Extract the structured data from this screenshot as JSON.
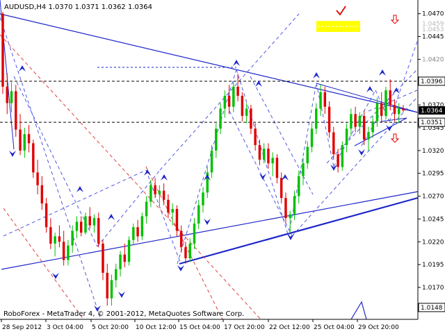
{
  "header": {
    "symbol_line": "AUDUSD,H4  1.0370 1.0371 1.0362 1.0364"
  },
  "footer": {
    "copyright": "RoboForex - MetaTrader 4, © 2001-2012, MetaQuotes Software Corp."
  },
  "chart_data": {
    "type": "candlestick",
    "symbol": "AUDUSD",
    "timeframe": "H4",
    "ohlc_current": {
      "open": 1.037,
      "high": 1.0371,
      "low": 1.0362,
      "close": 1.0364
    },
    "ylim": [
      1.0135,
      1.0485
    ],
    "x_tick_labels": [
      "28 Sep 2012",
      "3 Oct 04:00",
      "5 Oct 20:00",
      "10 Oct 12:00",
      "15 Oct 04:00",
      "17 Oct 20:00",
      "22 Oct 12:00",
      "25 Oct 04:00",
      "29 Oct 20:00"
    ],
    "y_tick_labels": [
      "1.0470",
      "1.0445",
      "1.0420",
      "1.0370",
      "1.0345",
      "1.0320",
      "1.0295",
      "1.0270",
      "1.0245",
      "1.0220",
      "1.0195",
      "1.0170"
    ],
    "y_tick_values": [
      1.047,
      1.0445,
      1.042,
      1.037,
      1.0345,
      1.032,
      1.0295,
      1.027,
      1.0245,
      1.022,
      1.0195,
      1.017
    ],
    "price_labels": [
      {
        "text": "1.0459",
        "value": 1.0459,
        "style": "muted"
      },
      {
        "text": "1.0453",
        "value": 1.0453,
        "style": "muted"
      },
      {
        "text": "1.0420",
        "value": 1.042,
        "style": "muted"
      },
      {
        "text": "1.0396",
        "value": 1.0396,
        "style": "boxed"
      },
      {
        "text": "1.0364",
        "value": 1.0364,
        "style": "current"
      },
      {
        "text": "1.0351",
        "value": 1.0351,
        "style": "boxed"
      },
      {
        "text": "1.0148",
        "value": 1.0148,
        "style": "boxed"
      }
    ],
    "horizontal_levels": [
      1.0396,
      1.0351
    ],
    "highlight_zone": {
      "y_top": 1.0462,
      "y_bottom": 1.045
    },
    "colors": {
      "bull": "#00c000",
      "bear": "#e00000",
      "trend": "#1c25c8",
      "dashed": "#5057e0",
      "diag_red": "#e04040",
      "zone": "#ffff00",
      "marker": "#e00000"
    },
    "candles": [
      [
        1.047,
        1.0472,
        1.0382,
        1.039
      ],
      [
        1.039,
        1.0405,
        1.036,
        1.0372
      ],
      [
        1.0372,
        1.0395,
        1.0362,
        1.0385
      ],
      [
        1.0385,
        1.0392,
        1.0335,
        1.0343
      ],
      [
        1.0343,
        1.036,
        1.0315,
        1.032
      ],
      [
        1.032,
        1.0345,
        1.0312,
        1.0338
      ],
      [
        1.0338,
        1.0348,
        1.0318,
        1.0328
      ],
      [
        1.0328,
        1.0332,
        1.029,
        1.0296
      ],
      [
        1.0296,
        1.031,
        1.0272,
        1.0282
      ],
      [
        1.0282,
        1.0292,
        1.0255,
        1.0262
      ],
      [
        1.0262,
        1.0268,
        1.023,
        1.0236
      ],
      [
        1.0236,
        1.0246,
        1.0212,
        1.0218
      ],
      [
        1.0218,
        1.023,
        1.0204,
        1.0226
      ],
      [
        1.0226,
        1.0238,
        1.0214,
        1.022
      ],
      [
        1.022,
        1.0232,
        1.0194,
        1.02
      ],
      [
        1.02,
        1.0222,
        1.0194,
        1.0216
      ],
      [
        1.0216,
        1.0238,
        1.0208,
        1.0232
      ],
      [
        1.0232,
        1.0248,
        1.0224,
        1.0242
      ],
      [
        1.0242,
        1.0248,
        1.0226,
        1.023
      ],
      [
        1.023,
        1.0252,
        1.0228,
        1.0248
      ],
      [
        1.0248,
        1.0258,
        1.0234,
        1.0238
      ],
      [
        1.0238,
        1.025,
        1.023,
        1.0246
      ],
      [
        1.0246,
        1.0252,
        1.0214,
        1.0218
      ],
      [
        1.0218,
        1.0222,
        1.0178,
        1.0186
      ],
      [
        1.0186,
        1.0196,
        1.015,
        1.0158
      ],
      [
        1.0158,
        1.0184,
        1.015,
        1.0178
      ],
      [
        1.0178,
        1.0196,
        1.017,
        1.019
      ],
      [
        1.019,
        1.021,
        1.0182,
        1.0206
      ],
      [
        1.0206,
        1.0218,
        1.0192,
        1.0198
      ],
      [
        1.0198,
        1.0226,
        1.0194,
        1.0222
      ],
      [
        1.0222,
        1.024,
        1.0216,
        1.0236
      ],
      [
        1.0236,
        1.0244,
        1.022,
        1.0226
      ],
      [
        1.0226,
        1.0252,
        1.0222,
        1.0248
      ],
      [
        1.0248,
        1.027,
        1.024,
        1.0264
      ],
      [
        1.0264,
        1.0288,
        1.0258,
        1.0282
      ],
      [
        1.0282,
        1.029,
        1.0268,
        1.0272
      ],
      [
        1.0272,
        1.0282,
        1.0258,
        1.0276
      ],
      [
        1.0276,
        1.0284,
        1.026,
        1.0266
      ],
      [
        1.0266,
        1.0272,
        1.0246,
        1.0252
      ],
      [
        1.0252,
        1.0262,
        1.0238,
        1.0256
      ],
      [
        1.0256,
        1.026,
        1.0226,
        1.0232
      ],
      [
        1.0232,
        1.0238,
        1.0208,
        1.0214
      ],
      [
        1.0214,
        1.022,
        1.0196,
        1.0202
      ],
      [
        1.0202,
        1.0224,
        1.0198,
        1.0218
      ],
      [
        1.0218,
        1.0246,
        1.0212,
        1.024
      ],
      [
        1.024,
        1.0266,
        1.0234,
        1.026
      ],
      [
        1.026,
        1.028,
        1.0252,
        1.0274
      ],
      [
        1.0274,
        1.0302,
        1.0268,
        1.0296
      ],
      [
        1.0296,
        1.0326,
        1.029,
        1.032
      ],
      [
        1.032,
        1.035,
        1.0312,
        1.0344
      ],
      [
        1.0344,
        1.0372,
        1.0338,
        1.0366
      ],
      [
        1.0366,
        1.0386,
        1.0356,
        1.038
      ],
      [
        1.038,
        1.0392,
        1.036,
        1.0368
      ],
      [
        1.0368,
        1.0396,
        1.0362,
        1.039
      ],
      [
        1.039,
        1.0404,
        1.0374,
        1.038
      ],
      [
        1.038,
        1.0384,
        1.0352,
        1.0358
      ],
      [
        1.0358,
        1.0372,
        1.035,
        1.0366
      ],
      [
        1.0366,
        1.037,
        1.0338,
        1.0344
      ],
      [
        1.0344,
        1.035,
        1.032,
        1.0326
      ],
      [
        1.0326,
        1.0332,
        1.0304,
        1.031
      ],
      [
        1.031,
        1.0328,
        1.0306,
        1.0322
      ],
      [
        1.0322,
        1.0328,
        1.03,
        1.0306
      ],
      [
        1.0306,
        1.0318,
        1.0292,
        1.0312
      ],
      [
        1.0312,
        1.0316,
        1.0284,
        1.029
      ],
      [
        1.029,
        1.0296,
        1.0262,
        1.0268
      ],
      [
        1.0268,
        1.0274,
        1.024,
        1.0246
      ],
      [
        1.0246,
        1.0254,
        1.023,
        1.025
      ],
      [
        1.025,
        1.0276,
        1.0244,
        1.027
      ],
      [
        1.027,
        1.0298,
        1.0262,
        1.0292
      ],
      [
        1.0292,
        1.0312,
        1.0282,
        1.0306
      ],
      [
        1.0306,
        1.033,
        1.03,
        1.0324
      ],
      [
        1.0324,
        1.035,
        1.0318,
        1.0344
      ],
      [
        1.0344,
        1.0372,
        1.0338,
        1.0366
      ],
      [
        1.0366,
        1.0392,
        1.0358,
        1.0384
      ],
      [
        1.0384,
        1.039,
        1.036,
        1.0368
      ],
      [
        1.0368,
        1.0374,
        1.0334,
        1.034
      ],
      [
        1.034,
        1.0346,
        1.031,
        1.0316
      ],
      [
        1.0316,
        1.0322,
        1.0296,
        1.0302
      ],
      [
        1.0302,
        1.033,
        1.0298,
        1.0326
      ],
      [
        1.0326,
        1.035,
        1.0318,
        1.0344
      ],
      [
        1.0344,
        1.0366,
        1.0336,
        1.036
      ],
      [
        1.036,
        1.0368,
        1.034,
        1.0346
      ],
      [
        1.0346,
        1.0362,
        1.0338,
        1.0358
      ],
      [
        1.0358,
        1.0364,
        1.0326,
        1.0332
      ],
      [
        1.0332,
        1.0346,
        1.032,
        1.034
      ],
      [
        1.034,
        1.0358,
        1.0334,
        1.0352
      ],
      [
        1.0352,
        1.0378,
        1.0346,
        1.0372
      ],
      [
        1.0372,
        1.0384,
        1.0352,
        1.0358
      ],
      [
        1.0358,
        1.039,
        1.0354,
        1.0386
      ],
      [
        1.0386,
        1.0398,
        1.0364,
        1.037
      ],
      [
        1.037,
        1.0376,
        1.0352,
        1.036
      ],
      [
        1.036,
        1.0372,
        1.035,
        1.0366
      ],
      [
        1.0366,
        1.037,
        1.0362,
        1.0364
      ]
    ]
  }
}
